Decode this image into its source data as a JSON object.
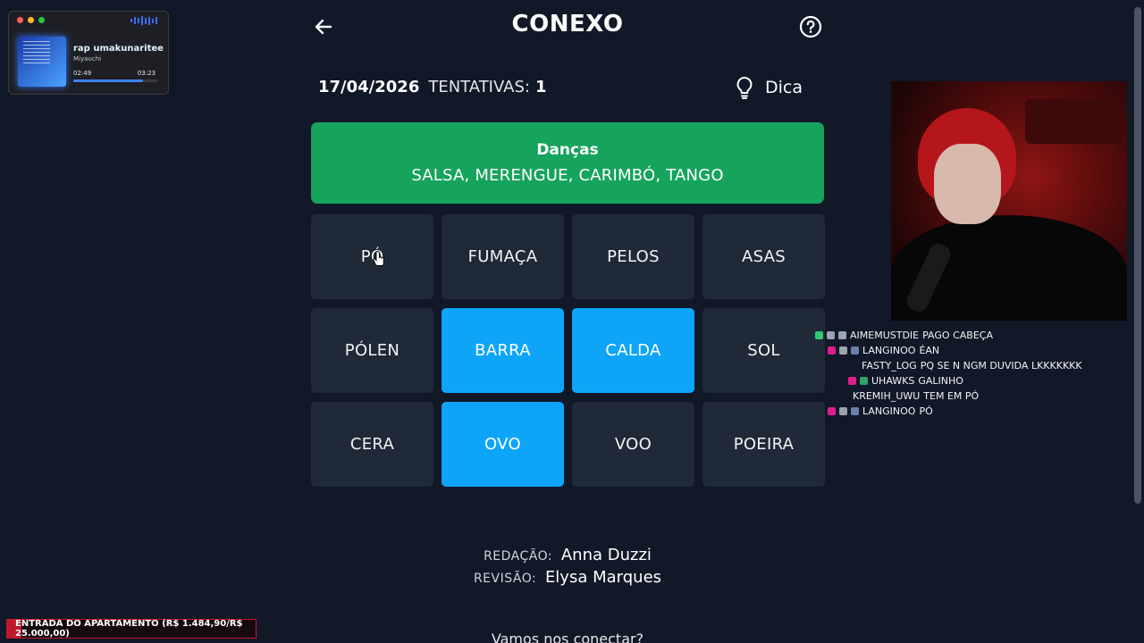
{
  "header": {
    "title": "CONEXO",
    "back_icon": "arrow-left-icon",
    "help_icon": "help-circle-icon"
  },
  "info": {
    "date": "17/04/2026",
    "attempts_label": "TENTATIVAS:",
    "attempts": "1"
  },
  "hint": {
    "icon": "lightbulb-icon",
    "label": "Dica"
  },
  "solved_group": {
    "name": "Danças",
    "words": "SALSA, MERENGUE, CARIMBÓ, TANGO",
    "color": "#16a35c"
  },
  "tiles": [
    {
      "word": "PÓ",
      "selected": false
    },
    {
      "word": "FUMAÇA",
      "selected": false
    },
    {
      "word": "PELOS",
      "selected": false
    },
    {
      "word": "ASAS",
      "selected": false
    },
    {
      "word": "PÓLEN",
      "selected": false
    },
    {
      "word": "BARRA",
      "selected": true
    },
    {
      "word": "CALDA",
      "selected": true
    },
    {
      "word": "SOL",
      "selected": false
    },
    {
      "word": "CERA",
      "selected": false
    },
    {
      "word": "OVO",
      "selected": true
    },
    {
      "word": "VOO",
      "selected": false
    },
    {
      "word": "POEIRA",
      "selected": false
    }
  ],
  "colors": {
    "background": "#111827",
    "tile": "#1f2937",
    "tile_selected": "#0ea5f9"
  },
  "credits": {
    "writing_label": "REDAÇÃO:",
    "writing_name": "Anna Duzzi",
    "review_label": "REVISÃO:",
    "review_name": "Elysa Marques",
    "connect": "Vamos nos conectar?"
  },
  "music_player": {
    "title": "rap umakunaritee",
    "artist": "Miyauchi",
    "current_time": "02:49",
    "total_time": "03:23",
    "progress": 0.83
  },
  "chat": [
    {
      "user": "AIMEMUSTDIE",
      "message": "PAGO CABEÇA"
    },
    {
      "user": "LANGINOO",
      "message": "ÉAN"
    },
    {
      "user": "FASTY_LOG",
      "message": "PQ SE N NGM DUVIDA LKKKKKKK"
    },
    {
      "user": "UHAWKS",
      "message": "GALINHO"
    },
    {
      "user": "KREMIH_UWU",
      "message": "TEM EM PÓ"
    },
    {
      "user": "LANGINOO",
      "message": "PÓ"
    }
  ],
  "goal": {
    "text": "ENTRADA DO APARTAMENTO (R$ 1.484,90/R$ 25.000,00)",
    "progress": 0.059
  }
}
